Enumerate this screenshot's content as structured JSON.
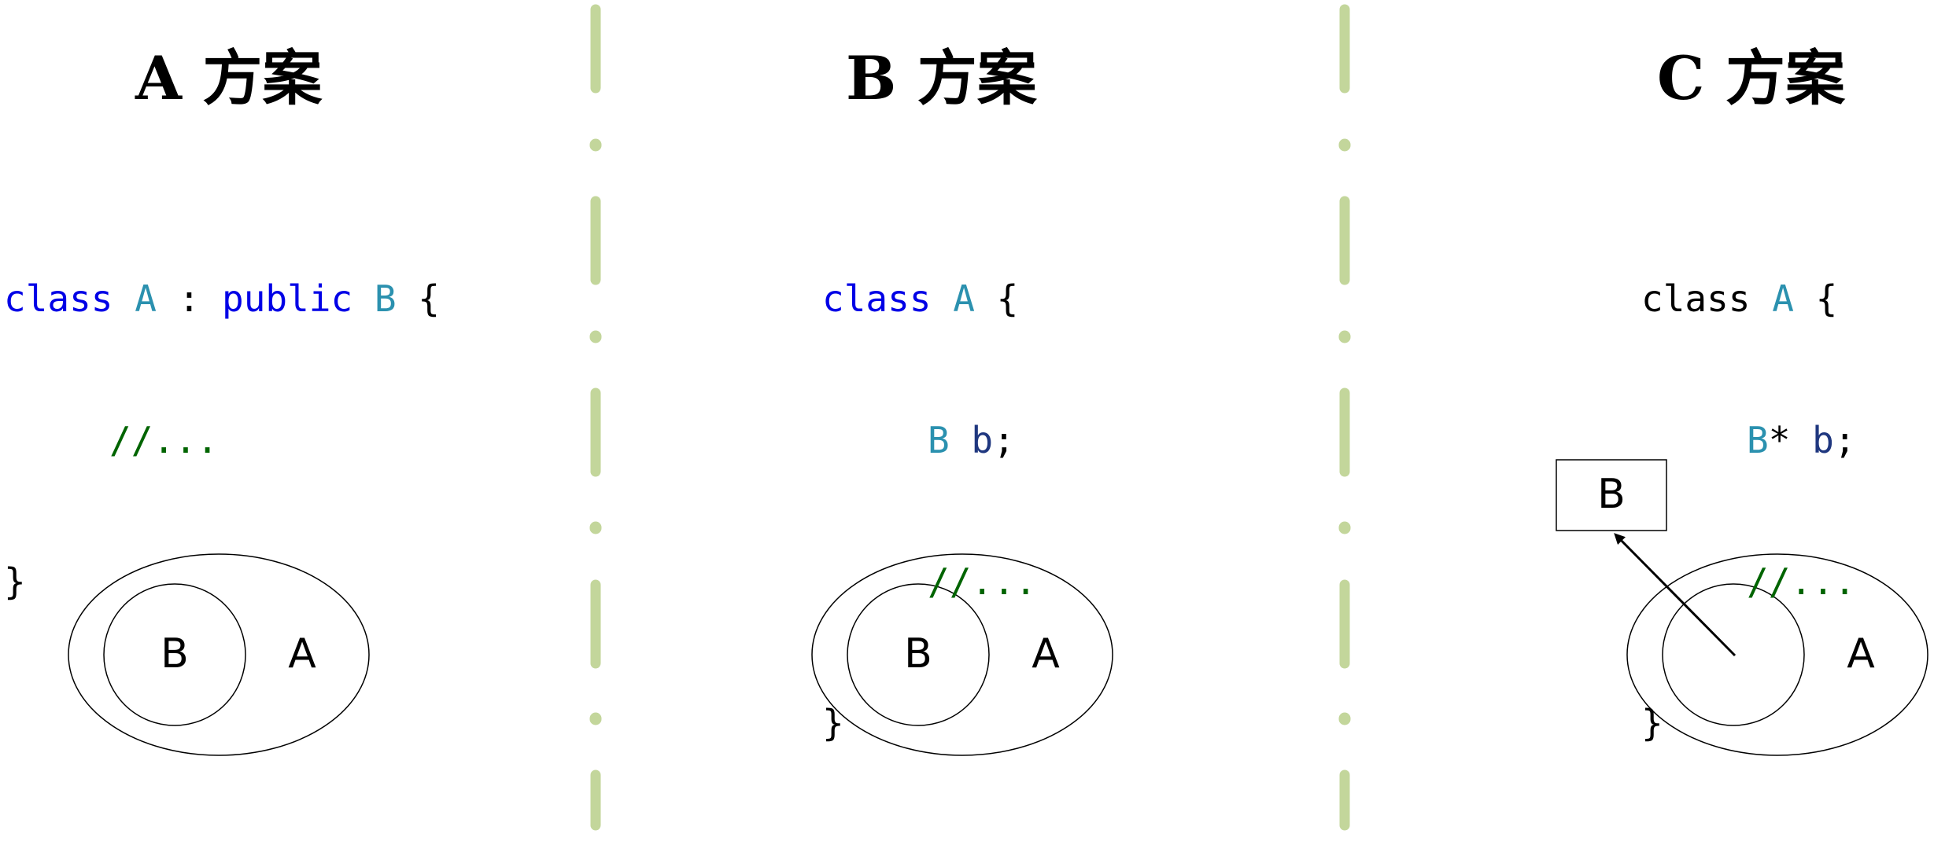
{
  "colors": {
    "divider": "#c3d69b",
    "keyword": "#0000e6",
    "type": "#2b91af",
    "comment": "#006400",
    "identifier": "#1f377f",
    "text": "#000000"
  },
  "panels": {
    "a": {
      "title": "A 方案",
      "code": {
        "l1_kw1": "class",
        "l1_ty1": "A",
        "l1_colon": ":",
        "l1_kw2": "public",
        "l1_ty2": "B",
        "l1_brace": "{",
        "l2_comment": "//...",
        "l3_brace": "}"
      },
      "diagram": {
        "inner_label": "B",
        "outer_label": "A"
      }
    },
    "b": {
      "title": "B 方案",
      "code": {
        "l1_kw": "class",
        "l1_ty": "A",
        "l1_brace": "{",
        "l2_ty": "B",
        "l2_id": "b",
        "l2_semi": ";",
        "l3_comment": "//...",
        "l4_brace": "}"
      },
      "diagram": {
        "inner_label": "B",
        "outer_label": "A"
      }
    },
    "c": {
      "title": "C 方案",
      "code": {
        "l1_kw": "class",
        "l1_ty": "A",
        "l1_brace": "{",
        "l2_ty": "B",
        "l2_star": "*",
        "l2_id": "b",
        "l2_semi": ";",
        "l3_comment": "//...",
        "l4_brace": "}"
      },
      "diagram": {
        "box_label": "B",
        "outer_label": "A"
      }
    }
  }
}
